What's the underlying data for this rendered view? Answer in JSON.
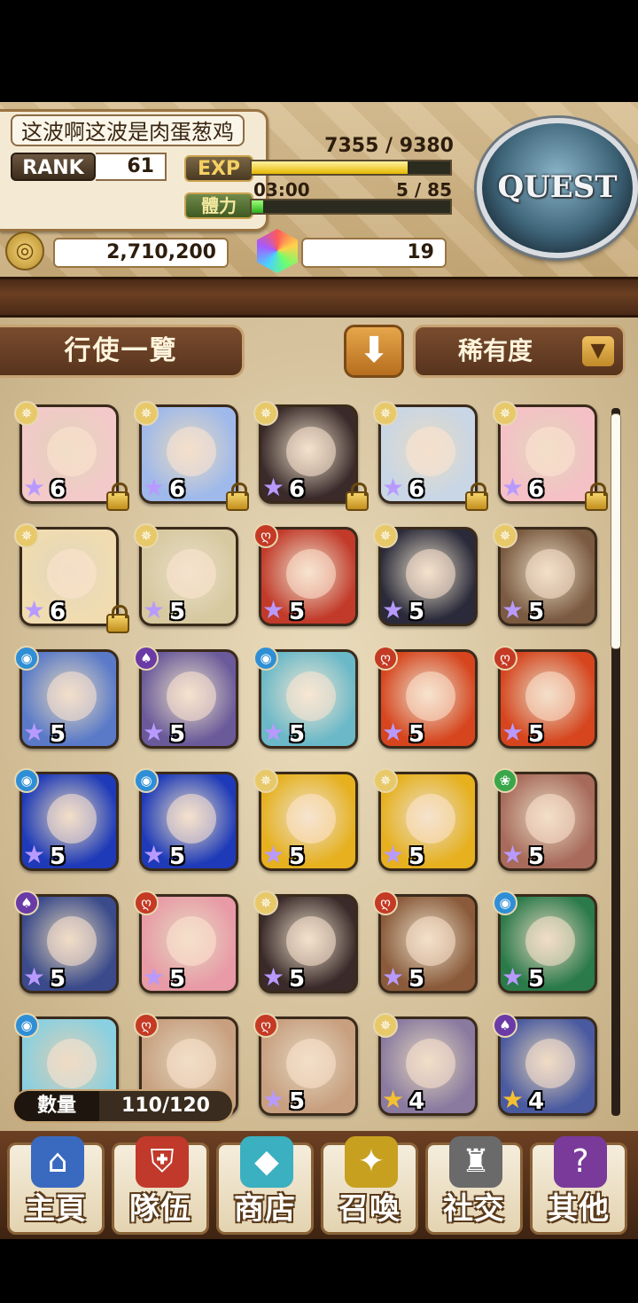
{
  "player": {
    "name": "这波啊这波是肉蛋葱鸡",
    "rank_label": "RANK",
    "rank": "61",
    "exp_label": "EXP",
    "exp_text": "7355 / 9380",
    "exp_progress": 0.784,
    "stamina_label": "體力",
    "stamina_timer": "03:00",
    "stamina_text": "5 / 85",
    "stamina_progress": 0.059
  },
  "currency": {
    "coins": "2,710,200",
    "gems": "19"
  },
  "quest_button": {
    "label": "QUEST"
  },
  "toolbar": {
    "list_title": "行使一覽",
    "sort_order_icon": "arrow-down-icon",
    "sort_select_label": "稀有度"
  },
  "element_colors": {
    "light": "#e8c96a",
    "fire": "#c43a24",
    "water": "#2f8fd6",
    "dark": "#6a3aa6",
    "wind": "#3aa64a"
  },
  "cards": [
    {
      "element": "light",
      "stars": "6",
      "locked": true,
      "bg": "#f3c9c9"
    },
    {
      "element": "light",
      "stars": "6",
      "locked": true,
      "bg": "#9fb9ea"
    },
    {
      "element": "light",
      "stars": "6",
      "locked": true,
      "bg": "#3a2a2a"
    },
    {
      "element": "light",
      "stars": "6",
      "locked": true,
      "bg": "#c8d6e6"
    },
    {
      "element": "light",
      "stars": "6",
      "locked": true,
      "bg": "#f5c0c6"
    },
    {
      "element": "light",
      "stars": "6",
      "locked": true,
      "bg": "#f0dcb0"
    },
    {
      "element": "light",
      "stars": "5",
      "locked": false,
      "bg": "#d6c9a0"
    },
    {
      "element": "fire",
      "stars": "5",
      "locked": false,
      "bg": "#c23a2a"
    },
    {
      "element": "light",
      "stars": "5",
      "locked": false,
      "bg": "#2a2a3a"
    },
    {
      "element": "light",
      "stars": "5",
      "locked": false,
      "bg": "#7a5a40"
    },
    {
      "element": "water",
      "stars": "5",
      "locked": false,
      "bg": "#5a7ac8"
    },
    {
      "element": "dark",
      "stars": "5",
      "locked": false,
      "bg": "#6a5a9a"
    },
    {
      "element": "water",
      "stars": "5",
      "locked": false,
      "bg": "#6ab8c8"
    },
    {
      "element": "fire",
      "stars": "5",
      "locked": false,
      "bg": "#d6451e"
    },
    {
      "element": "fire",
      "stars": "5",
      "locked": false,
      "bg": "#d6451e"
    },
    {
      "element": "water",
      "stars": "5",
      "locked": false,
      "bg": "#1e3ab8"
    },
    {
      "element": "water",
      "stars": "5",
      "locked": false,
      "bg": "#1e3ab8"
    },
    {
      "element": "light",
      "stars": "5",
      "locked": false,
      "bg": "#e6b01e"
    },
    {
      "element": "light",
      "stars": "5",
      "locked": false,
      "bg": "#e6b01e"
    },
    {
      "element": "wind",
      "stars": "5",
      "locked": false,
      "bg": "#a86a5a"
    },
    {
      "element": "dark",
      "stars": "5",
      "locked": false,
      "bg": "#3a4a8a"
    },
    {
      "element": "fire",
      "stars": "5",
      "locked": false,
      "bg": "#e89aa6"
    },
    {
      "element": "light",
      "stars": "5",
      "locked": false,
      "bg": "#3a2a2a"
    },
    {
      "element": "fire",
      "stars": "5",
      "locked": false,
      "bg": "#8a5a3a"
    },
    {
      "element": "water",
      "stars": "5",
      "locked": false,
      "bg": "#2a7a4a"
    },
    {
      "element": "water",
      "stars": "",
      "locked": false,
      "bg": "#8ad0e0"
    },
    {
      "element": "fire",
      "stars": "",
      "locked": false,
      "bg": "#c8a080"
    },
    {
      "element": "fire",
      "stars": "5",
      "locked": false,
      "bg": "#c8a080"
    },
    {
      "element": "light",
      "stars": "4",
      "locked": false,
      "bg": "#8a7aa0"
    },
    {
      "element": "dark",
      "stars": "4",
      "locked": false,
      "bg": "#4a5aa0"
    }
  ],
  "scroll": {
    "position": 0
  },
  "count": {
    "label": "數量",
    "value": "110/120"
  },
  "nav": [
    {
      "label": "主頁",
      "icon": "house-icon",
      "color": "#3a6ac0"
    },
    {
      "label": "隊伍",
      "icon": "shield-icon",
      "color": "#c0392b"
    },
    {
      "label": "商店",
      "icon": "gem-icon",
      "color": "#3ab0c0"
    },
    {
      "label": "召喚",
      "icon": "summon-icon",
      "color": "#c8a020"
    },
    {
      "label": "社交",
      "icon": "knight-helmet-icon",
      "color": "#6a6a6a"
    },
    {
      "label": "其他",
      "icon": "question-box-icon",
      "color": "#7a3a9a"
    }
  ]
}
